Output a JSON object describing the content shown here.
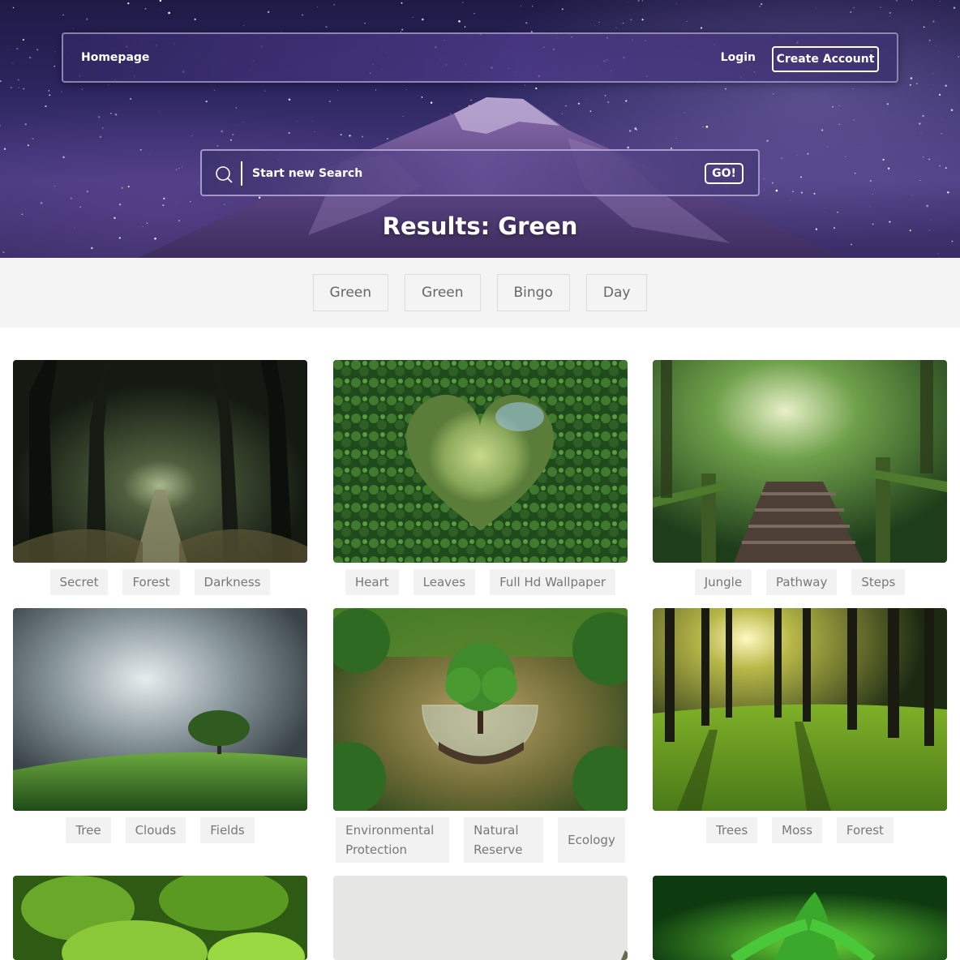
{
  "nav": {
    "home_label": "Homepage",
    "login_label": "Login",
    "create_account_label": "Create Account"
  },
  "search": {
    "placeholder": "Start new Search",
    "go_label": "GO!"
  },
  "results_title": "Results: Green",
  "filter_tags": [
    "Green",
    "Green",
    "Bingo",
    "Day"
  ],
  "cards": [
    {
      "tags": [
        "Secret",
        "Forest",
        "Darkness"
      ]
    },
    {
      "tags": [
        "Heart",
        "Leaves",
        "Full Hd Wallpaper"
      ]
    },
    {
      "tags": [
        "Jungle",
        "Pathway",
        "Steps"
      ]
    },
    {
      "tags": [
        "Tree",
        "Clouds",
        "Fields"
      ]
    },
    {
      "tags": [
        "Environmental Protection",
        "Natural Reserve",
        "Ecology"
      ]
    },
    {
      "tags": [
        "Trees",
        "Moss",
        "Forest"
      ]
    }
  ],
  "icons": {
    "search": "search-icon"
  }
}
